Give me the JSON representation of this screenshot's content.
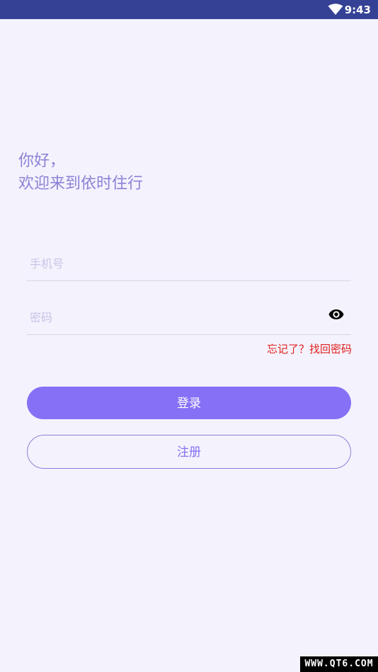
{
  "status_bar": {
    "time": "9:43",
    "wifi_icon": "wifi-icon",
    "background_color": "#344195"
  },
  "greeting": {
    "line1": "你好，",
    "line2": "欢迎来到依时住行"
  },
  "form": {
    "phone": {
      "placeholder": "手机号",
      "value": ""
    },
    "password": {
      "placeholder": "密码",
      "value": "",
      "toggle_icon": "eye-icon"
    },
    "forgot_link": "忘记了？找回密码"
  },
  "buttons": {
    "login_label": "登录",
    "register_label": "注册"
  },
  "watermark": "WWW.QT6.COM",
  "colors": {
    "background": "#f4f2fd",
    "accent": "#8670f5",
    "greeting_text": "#8b82d6",
    "link": "#e0211e"
  }
}
